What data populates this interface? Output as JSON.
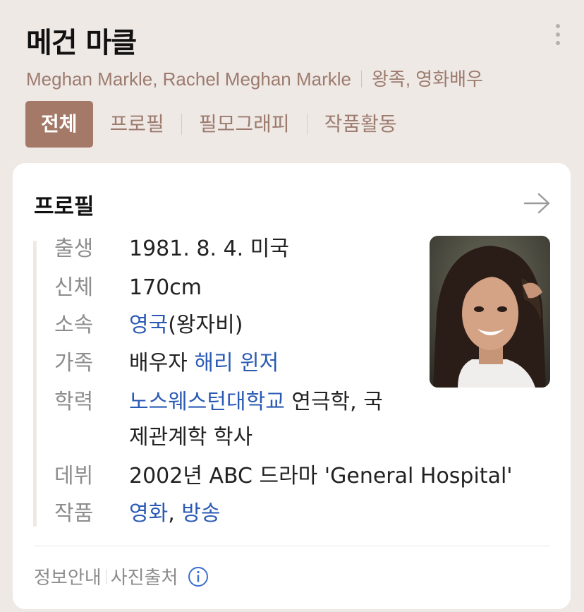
{
  "header": {
    "title": "메건 마클",
    "names": "Meghan Markle, Rachel Meghan Markle",
    "category": "왕족, 영화배우",
    "more_icon": "more-vertical-icon"
  },
  "tabs": [
    {
      "label": "전체",
      "active": true
    },
    {
      "label": "프로필",
      "active": false
    },
    {
      "label": "필모그래피",
      "active": false
    },
    {
      "label": "작품활동",
      "active": false
    }
  ],
  "profile": {
    "title": "프로필",
    "arrow_icon": "arrow-right-icon",
    "birth": {
      "label": "출생",
      "value": "1981. 8. 4. 미국"
    },
    "body": {
      "label": "신체",
      "value": "170cm"
    },
    "affiliation": {
      "label": "소속",
      "link": "영국",
      "suffix": "(왕자비)"
    },
    "family": {
      "label": "가족",
      "prefix": "배우자 ",
      "link": "해리 윈저"
    },
    "education": {
      "label": "학력",
      "link": "노스웨스턴대학교",
      "line1_suffix": " 연극학, 국",
      "line2": "제관계학 학사"
    },
    "debut": {
      "label": "데뷔",
      "value": "2002년 ABC 드라마 'General Hospital'"
    },
    "works": {
      "label": "작품",
      "link1": "영화",
      "comma": ", ",
      "link2": "방송"
    }
  },
  "footer": {
    "info_label": "정보안내",
    "photo_source": "사진출처",
    "info_icon": "info-circle-icon"
  },
  "colors": {
    "page_bg": "#efe9e6",
    "accent": "#a57968",
    "link": "#2a5ab5",
    "muted_brown": "#9c7b6e"
  }
}
